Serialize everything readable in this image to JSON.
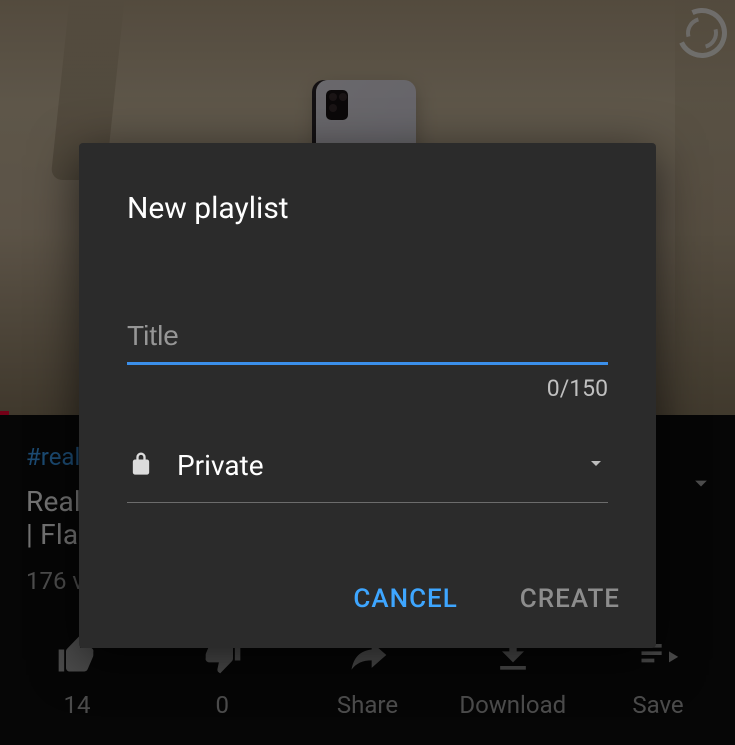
{
  "background": {
    "hashtag": "#real",
    "title_line1": "Real",
    "title_line2": "| Fla",
    "views_text": "176 v",
    "actions": {
      "like_count": "14",
      "dislike_count": "0",
      "share_label": "Share",
      "download_label": "Download",
      "save_label": "Save"
    }
  },
  "dialog": {
    "title": "New playlist",
    "title_input": {
      "placeholder": "Title",
      "value": "",
      "counter": "0/150"
    },
    "privacy": {
      "selected": "Private"
    },
    "cancel_label": "CANCEL",
    "create_label": "CREATE"
  }
}
